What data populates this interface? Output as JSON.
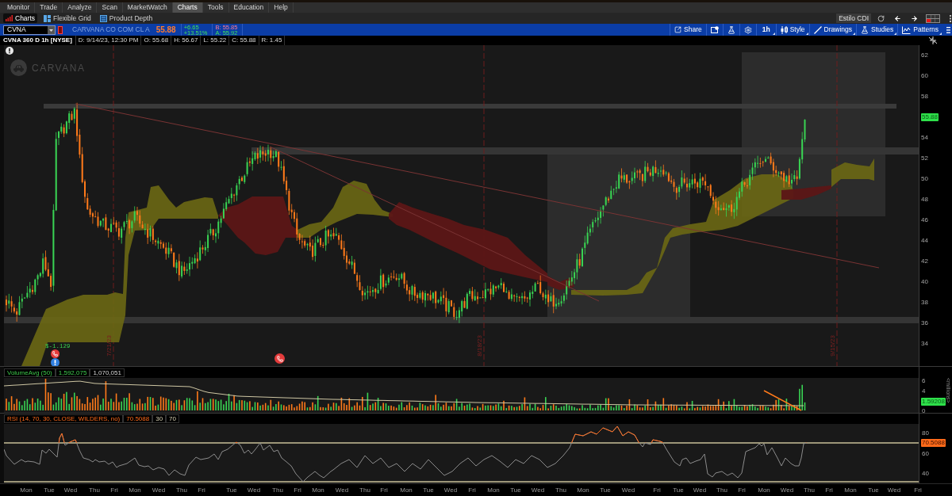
{
  "menu_bar": [
    {
      "label": "Monitor",
      "selected": false
    },
    {
      "label": "Trade",
      "selected": false
    },
    {
      "label": "Analyze",
      "selected": false
    },
    {
      "label": "Scan",
      "selected": false
    },
    {
      "label": "MarketWatch",
      "selected": false
    },
    {
      "label": "Charts",
      "selected": true
    },
    {
      "label": "Tools",
      "selected": false
    },
    {
      "label": "Education",
      "selected": false
    },
    {
      "label": "Help",
      "selected": false
    }
  ],
  "sub_tabs": [
    {
      "label": "Charts",
      "selected": true
    },
    {
      "label": "Flexible Grid",
      "selected": false
    },
    {
      "label": "Product Depth",
      "selected": false
    }
  ],
  "style_preset": "Estilo CDI",
  "quote": {
    "symbol": "CVNA",
    "company": "CARVANA CO COM CL A",
    "last": "55.88",
    "change": "+6.65",
    "change_percent": "+13.51%",
    "bid": "B: 55.85",
    "ask": "A: 55.92"
  },
  "chart_toolbar": {
    "share": "Share",
    "aggregation": "1h",
    "style": "Style",
    "drawings": "Drawings",
    "studies": "Studies",
    "patterns": "Patterns"
  },
  "chart_header": {
    "title": "CVNA 360 D 1h [NYSE]",
    "fields": [
      "D: 9/14/23, 12:30 PM",
      "O: 55.68",
      "H: 56.67",
      "L: 55.22",
      "C: 55.88",
      "R: 1.45"
    ]
  },
  "price_chart": {
    "logo": "CARVANA",
    "date_markers": [
      "7/21/23",
      "8/18/23",
      "9/15/23"
    ],
    "earnings": "$-1.129",
    "axis": [
      {
        "kind": "tick",
        "label": "62"
      },
      {
        "kind": "tick",
        "label": "60"
      },
      {
        "kind": "tick",
        "label": "58"
      },
      {
        "kind": "last",
        "label": "55.88"
      },
      {
        "kind": "tick",
        "label": "54"
      },
      {
        "kind": "tick",
        "label": "52"
      },
      {
        "kind": "tick",
        "label": "50"
      },
      {
        "kind": "tick",
        "label": "48"
      },
      {
        "kind": "tick",
        "label": "46"
      },
      {
        "kind": "tick",
        "label": "44"
      },
      {
        "kind": "tick",
        "label": "42"
      },
      {
        "kind": "tick",
        "label": "40"
      },
      {
        "kind": "tick",
        "label": "38"
      },
      {
        "kind": "tick",
        "label": "36"
      },
      {
        "kind": "tick",
        "label": "34"
      }
    ]
  },
  "volume": {
    "title": "VolumeAvg (50)",
    "readings": [
      {
        "text": "1,592,075",
        "kind": "volume"
      },
      {
        "text": "1,070,051",
        "kind": "average"
      }
    ],
    "axis": [
      {
        "kind": "tick",
        "label": "6"
      },
      {
        "kind": "tick",
        "label": "4"
      },
      {
        "kind": "last",
        "label": "1.59208"
      },
      {
        "kind": "tick",
        "label": "0"
      }
    ],
    "unit": "<millions>"
  },
  "rsi": {
    "title": "RSI (14, 70, 30, CLOSE, WILDERS, no)",
    "readings": [
      {
        "text": "70.5088",
        "kind": "value"
      },
      {
        "text": "30",
        "kind": "level"
      },
      {
        "text": "70",
        "kind": "level"
      }
    ],
    "axis": [
      {
        "kind": "tick",
        "label": "80"
      },
      {
        "kind": "last",
        "label": "70.5088"
      },
      {
        "kind": "tick",
        "label": "60"
      },
      {
        "kind": "tick",
        "label": "40"
      }
    ]
  },
  "time_axis": [
    "Mon",
    "Tue",
    "Wed",
    "Thu",
    "Fri",
    "Mon",
    "Wed",
    "Thu",
    "Fri",
    "Tue",
    "Wed",
    "Thu",
    "Fri",
    "Mon",
    "Wed",
    "Thu",
    "Fri",
    "Mon",
    "Tue",
    "Wed",
    "Fri",
    "Mon",
    "Tue",
    "Wed",
    "Thu",
    "Mon",
    "Tue",
    "Wed",
    "Fri",
    "Tue",
    "Wed",
    "Thu",
    "Fri",
    "Mon",
    "Wed",
    "Thu",
    "Fri",
    "Mon",
    "Tue",
    "Wed",
    "Fri"
  ]
}
